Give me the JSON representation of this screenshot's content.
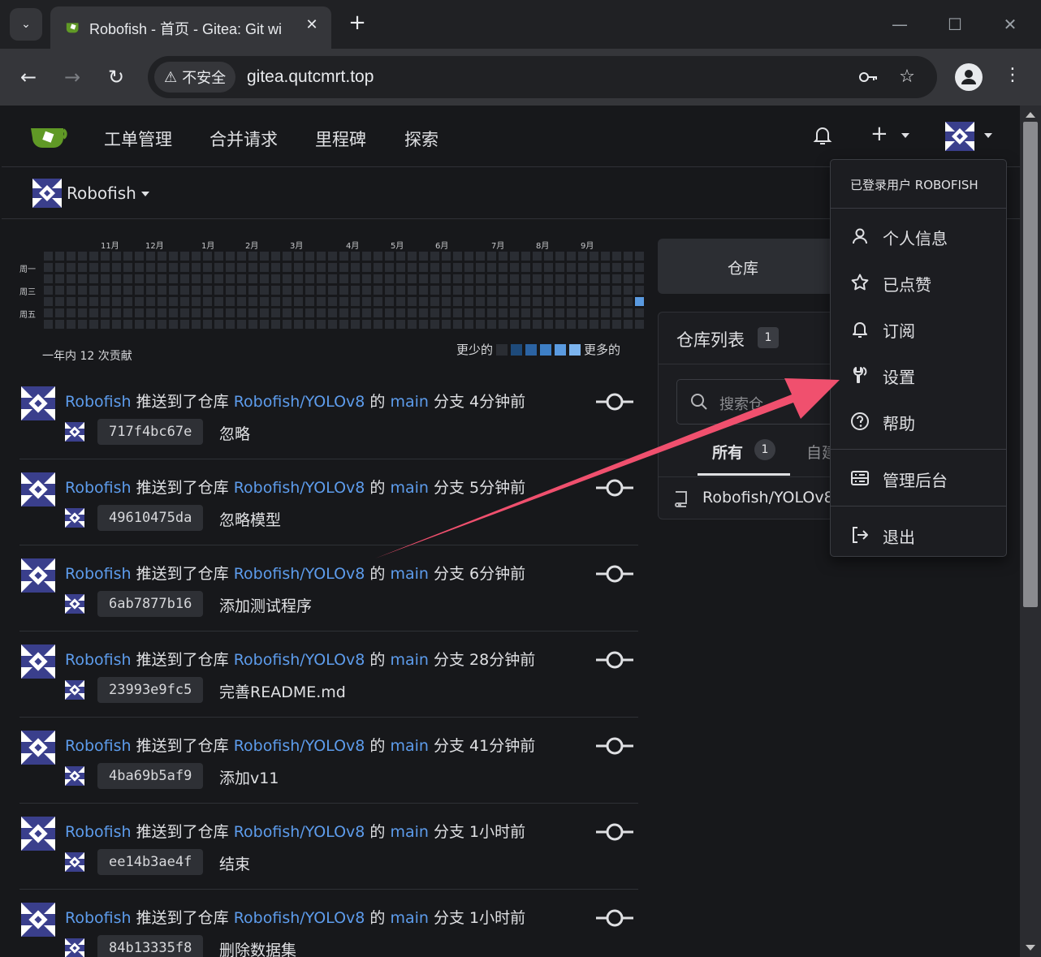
{
  "browser": {
    "tab_title": "Robofish - 首页 - Gitea: Git wi",
    "security_label": "不安全",
    "url": "gitea.qutcmrt.top"
  },
  "nav": {
    "links": [
      "工单管理",
      "合并请求",
      "里程碑",
      "探索"
    ]
  },
  "context": {
    "user": "Robofish"
  },
  "heatmap": {
    "months": [
      "11月",
      "12月",
      "1月",
      "2月",
      "3月",
      "4月",
      "5月",
      "6月",
      "7月",
      "8月",
      "9月"
    ],
    "days": [
      "周一",
      "周三",
      "周五"
    ],
    "total": "一年内 12 次贡献",
    "less": "更少的",
    "more": "更多的",
    "colors": [
      "#2a2d33",
      "#1e4a7a",
      "#2b63a3",
      "#3e7fc6",
      "#5a9ae0",
      "#7cb4ee"
    ]
  },
  "feed": [
    {
      "user": "Robofish",
      "action": "推送到了仓库",
      "repo": "Robofish/YOLOv8",
      "of": "的",
      "branch": "main",
      "suffix": "分支 4分钟前",
      "sha": "717f4bc67e",
      "msg": "忽略"
    },
    {
      "user": "Robofish",
      "action": "推送到了仓库",
      "repo": "Robofish/YOLOv8",
      "of": "的",
      "branch": "main",
      "suffix": "分支 5分钟前",
      "sha": "49610475da",
      "msg": "忽略模型"
    },
    {
      "user": "Robofish",
      "action": "推送到了仓库",
      "repo": "Robofish/YOLOv8",
      "of": "的",
      "branch": "main",
      "suffix": "分支 6分钟前",
      "sha": "6ab7877b16",
      "msg": "添加测试程序"
    },
    {
      "user": "Robofish",
      "action": "推送到了仓库",
      "repo": "Robofish/YOLOv8",
      "of": "的",
      "branch": "main",
      "suffix": "分支 28分钟前",
      "sha": "23993e9fc5",
      "msg": "完善README.md"
    },
    {
      "user": "Robofish",
      "action": "推送到了仓库",
      "repo": "Robofish/YOLOv8",
      "of": "的",
      "branch": "main",
      "suffix": "分支 41分钟前",
      "sha": "4ba69b5af9",
      "msg": "添加v11"
    },
    {
      "user": "Robofish",
      "action": "推送到了仓库",
      "repo": "Robofish/YOLOv8",
      "of": "的",
      "branch": "main",
      "suffix": "分支 1小时前",
      "sha": "ee14b3ae4f",
      "msg": "结束"
    },
    {
      "user": "Robofish",
      "action": "推送到了仓库",
      "repo": "Robofish/YOLOv8",
      "of": "的",
      "branch": "main",
      "suffix": "分支 1小时前",
      "sha": "84b13335f8",
      "msg": "删除数据集"
    }
  ],
  "right_panel": {
    "tab": "仓库",
    "title": "仓库列表",
    "count": "1",
    "search_placeholder": "搜索仓",
    "filter_all": "所有",
    "filter_all_count": "1",
    "filter_other": "自建",
    "repo": "Robofish/YOLOv8"
  },
  "dropdown": {
    "header": "已登录用户 ROBOFISH",
    "items": [
      {
        "label": "个人信息",
        "icon": "person-icon"
      },
      {
        "label": "已点赞",
        "icon": "star-icon"
      },
      {
        "label": "订阅",
        "icon": "bell-icon"
      },
      {
        "label": "设置",
        "icon": "tools-icon"
      },
      {
        "label": "帮助",
        "icon": "question-icon"
      },
      {
        "label": "管理后台",
        "icon": "server-icon"
      },
      {
        "label": "退出",
        "icon": "sign-out-icon"
      }
    ]
  },
  "annotation": {
    "arrow_color": "#f0506e"
  }
}
